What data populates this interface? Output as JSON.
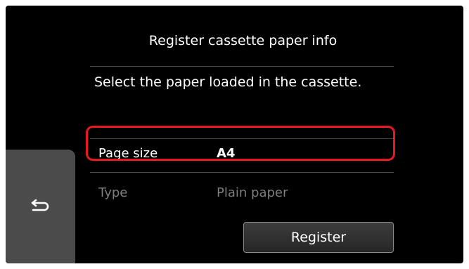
{
  "screen": {
    "title": "Register cassette paper info",
    "message": "Select the paper loaded in the cassette."
  },
  "settings": [
    {
      "label": "Page size",
      "value": "A4"
    },
    {
      "label": "Type",
      "value": "Plain paper"
    }
  ],
  "buttons": {
    "back_icon": "back-arrow-icon",
    "register_label": "Register"
  },
  "colors": {
    "highlight": "#e61922",
    "background": "#000000",
    "back_button": "#4b4b4b",
    "disabled_text": "#7e7e7e"
  }
}
